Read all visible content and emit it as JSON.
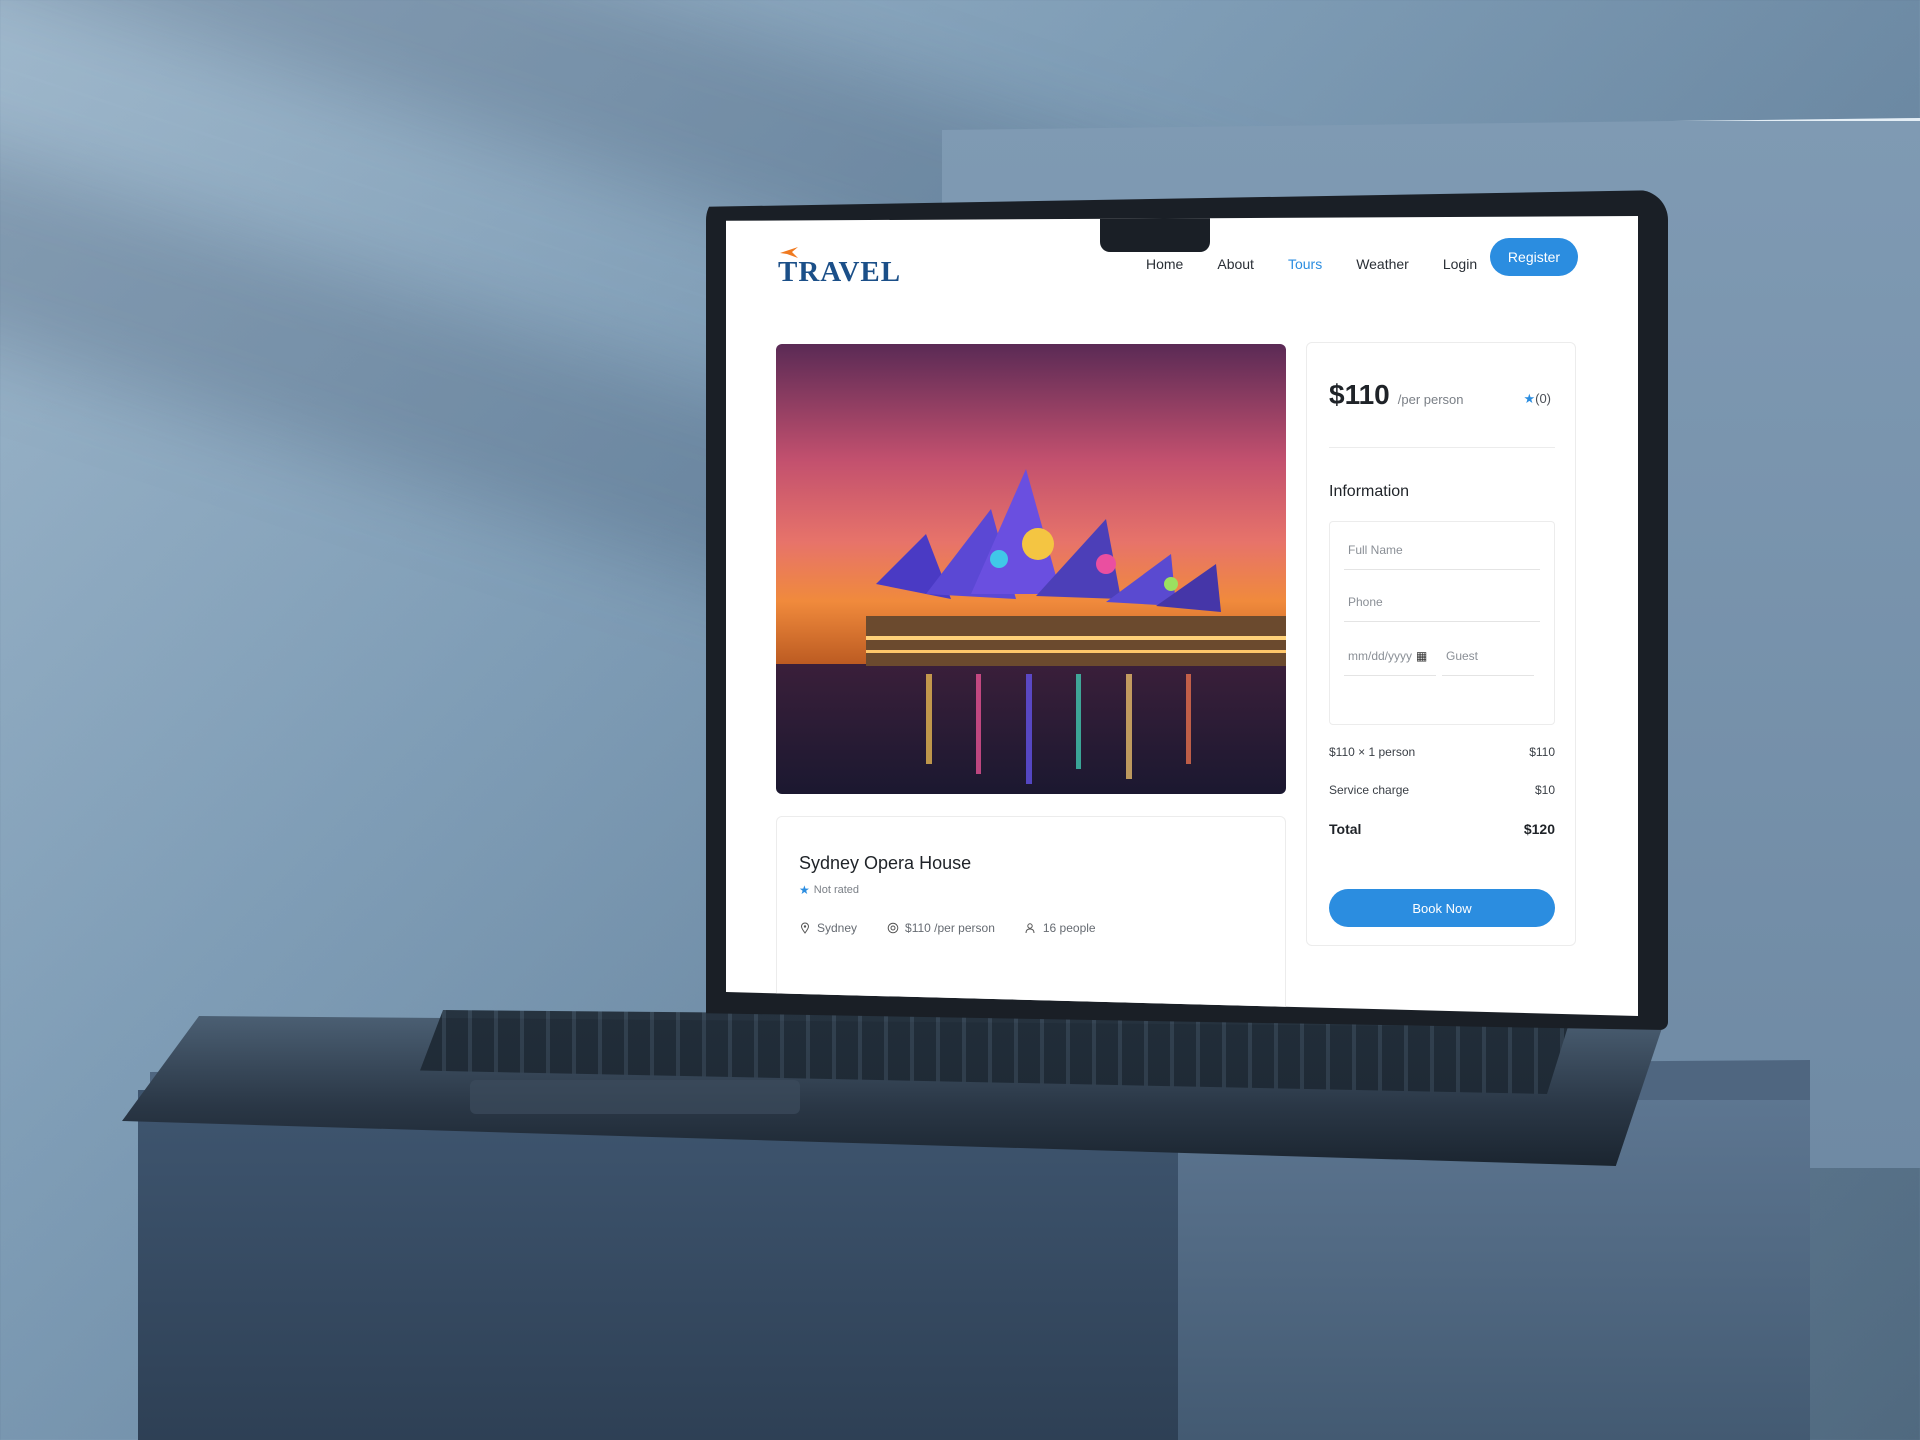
{
  "brand": {
    "logo_text": "TRAVEL"
  },
  "nav": {
    "items": [
      {
        "label": "Home",
        "active": false
      },
      {
        "label": "About",
        "active": false
      },
      {
        "label": "Tours",
        "active": true
      },
      {
        "label": "Weather",
        "active": false
      },
      {
        "label": "Login",
        "active": false
      }
    ],
    "register_label": "Register"
  },
  "hero": {
    "image": "Sydney Opera House at night"
  },
  "tour": {
    "title": "Sydney Opera House",
    "rating_text": "Not rated",
    "location": "Sydney",
    "price_text": "$110 /per person",
    "group_size": "16 people"
  },
  "booking": {
    "price": "$110",
    "per_label": "/per person",
    "rating_count": "(0)",
    "info_title": "Information",
    "fields": {
      "full_name_placeholder": "Full Name",
      "phone_placeholder": "Phone",
      "date_placeholder": "mm/dd/yyyy",
      "guest_placeholder": "Guest"
    },
    "lines": [
      {
        "label": "$110 × 1 person",
        "value": "$110"
      },
      {
        "label": "Service charge",
        "value": "$10"
      }
    ],
    "total": {
      "label": "Total",
      "value": "$120"
    },
    "book_label": "Book Now"
  },
  "colors": {
    "accent": "#2b8de0",
    "logo": "#1b4f88",
    "plane": "#f07a20"
  }
}
